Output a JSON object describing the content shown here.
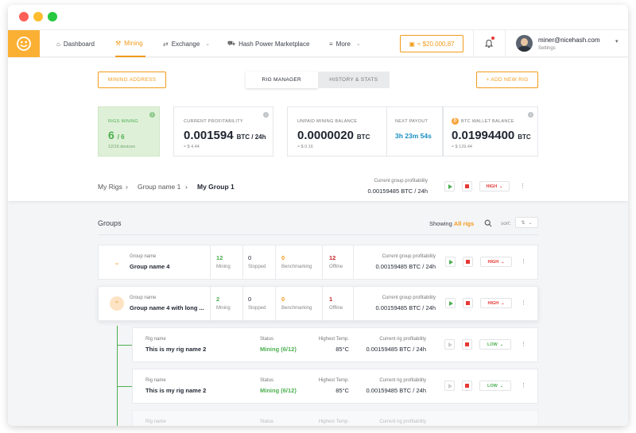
{
  "nav": {
    "items": [
      {
        "label": "Dashboard",
        "icon": "home-icon"
      },
      {
        "label": "Mining",
        "icon": "pickaxe-icon",
        "active": true
      },
      {
        "label": "Exchange",
        "icon": "exchange-icon"
      },
      {
        "label": "Hash Power Marketplace",
        "icon": "cart-icon"
      },
      {
        "label": "More",
        "icon": "more-icon"
      }
    ],
    "balance": "≈ $20.000,87",
    "user_email": "miner@nicehash.com",
    "user_sub": "Settings"
  },
  "toolbar": {
    "mining_address": "MINING ADDRESS",
    "tab_rig_manager": "RIG MANAGER",
    "tab_history": "HISTORY & STATS",
    "add_rig": "+ ADD NEW RIG"
  },
  "stats": {
    "rigs_mining": {
      "label": "RIGS MINING",
      "value": "6",
      "total": "/ 6",
      "sub": "12/16 devices"
    },
    "profitability": {
      "label": "CURRENT PROFITABILITY",
      "value": "0.001594",
      "unit": "BTC / 24h",
      "sub": "≈ $ 4.44"
    },
    "unpaid": {
      "label": "UNPAID MINING BALANCE",
      "value": "0.0000020",
      "unit": "BTC",
      "sub": "≈ $ 0.16"
    },
    "next_payout": {
      "label": "NEXT PAYOUT",
      "value": "3h 23m 54s"
    },
    "wallet": {
      "label": "BTC WALLET BALANCE",
      "value": "0.01994400",
      "unit": "BTC",
      "sub": "≈ $ 129.44"
    }
  },
  "breadcrumb": {
    "root": "My Rigs",
    "parent": "Group name 1",
    "current": "My Group 1"
  },
  "group_profit": {
    "label": "Current group profitability",
    "value": "0.00159485 BTC / 24h",
    "power": "HIGH"
  },
  "list": {
    "title": "Groups",
    "showing_prefix": "Showing",
    "showing_value": "All rigs",
    "sort_label": "sort:"
  },
  "groups": [
    {
      "label": "Group name",
      "name": "Group name 4",
      "mining": "12",
      "stopped": "0",
      "benchmarking": "0",
      "offline": "12",
      "profit_label": "Current group profitability",
      "profit": "0.00159485 BTC / 24h",
      "power": "HIGH"
    },
    {
      "label": "Group name",
      "name": "Group name 4 with long ...",
      "mining": "2",
      "stopped": "0",
      "benchmarking": "0",
      "offline": "1",
      "profit_label": "Current group profitability",
      "profit": "0.00159485 BTC / 24h",
      "power": "HIGH"
    }
  ],
  "count_labels": {
    "mining": "Mining",
    "stopped": "Stopped",
    "benchmarking": "Benchmarking",
    "offline": "Offline"
  },
  "rigs": [
    {
      "label": "Rig name",
      "name": "This is my rig name 2",
      "status_label": "Status",
      "status": "Mining (6/12)",
      "temp_label": "Highest Temp.",
      "temp": "85°C",
      "profit_label": "Current rig profitability",
      "profit": "0.00159485 BTC / 24h",
      "power": "LOW"
    },
    {
      "label": "Rig name",
      "name": "This is my rig name 2",
      "status_label": "Status",
      "status": "Mining (6/12)",
      "temp_label": "Highest Temp.",
      "temp": "85°C",
      "profit_label": "Current rig profitability",
      "profit": "0.00159485 BTC / 24h",
      "power": "LOW"
    },
    {
      "label": "Rig name",
      "name": "",
      "status_label": "Status",
      "status": "",
      "temp_label": "Highest Temp.",
      "temp": "",
      "profit_label": "Current rig profitability",
      "profit": "",
      "power": ""
    }
  ],
  "colors": {
    "accent": "#f29b1b",
    "green": "#4caf50",
    "red": "#e53935"
  }
}
